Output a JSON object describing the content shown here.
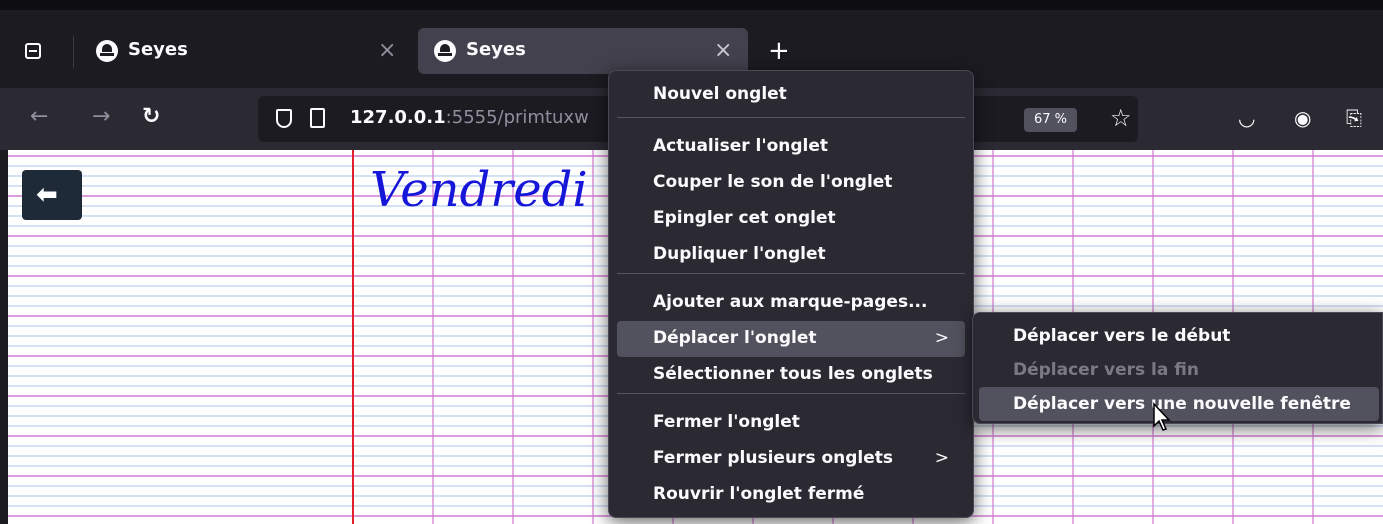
{
  "tabs": [
    {
      "title": "Seyes",
      "active": false
    },
    {
      "title": "Seyes",
      "active": true
    }
  ],
  "navbar": {
    "url_host": "127.0.0.1",
    "url_rest": ":5555/primtuxw",
    "zoom": "67 %"
  },
  "page": {
    "day_title": "Vendredi"
  },
  "context_menu": {
    "items": [
      {
        "label": "Nouvel onglet"
      },
      {
        "label": "Actualiser l'onglet"
      },
      {
        "label": "Couper le son de l'onglet"
      },
      {
        "label": "Epingler cet onglet"
      },
      {
        "label": "Dupliquer l'onglet"
      },
      {
        "label": "Ajouter aux marque-pages..."
      },
      {
        "label": "Déplacer l'onglet",
        "submenu": true
      },
      {
        "label": "Sélectionner tous les onglets"
      },
      {
        "label": "Fermer l'onglet"
      },
      {
        "label": "Fermer plusieurs onglets",
        "submenu": true
      },
      {
        "label": "Rouvrir l'onglet fermé"
      }
    ],
    "arrow_glyph": ">"
  },
  "submenu": {
    "items": [
      {
        "label": "Déplacer vers le début",
        "disabled": false
      },
      {
        "label": "Déplacer vers la fin",
        "disabled": true
      },
      {
        "label": "Déplacer vers une nouvelle fenêtre",
        "disabled": false
      }
    ]
  },
  "colors": {
    "menu_bg": "#2b2a33",
    "menu_hover": "#52525e",
    "seyes_blue": "#a9c4ec",
    "seyes_magenta": "#d07ad0",
    "margin_red": "#e0202a",
    "title_blue": "#1616d9"
  }
}
